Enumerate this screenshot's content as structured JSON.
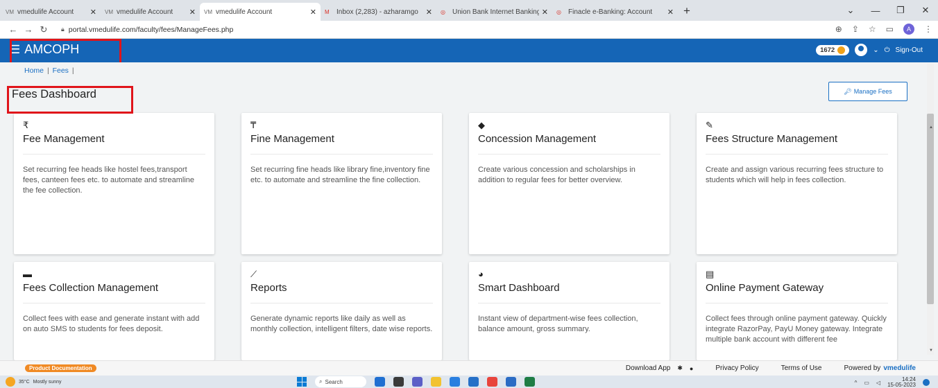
{
  "browser": {
    "tabs": [
      {
        "title": "vmedulife Account"
      },
      {
        "title": "vmedulife Account"
      },
      {
        "title": "vmedulife Account"
      },
      {
        "title": "Inbox (2,283) - azharamgo"
      },
      {
        "title": "Union Bank Internet Banking"
      },
      {
        "title": "Finacle e-Banking: Account"
      }
    ],
    "url": "portal.vmedulife.com/faculty/fees/ManageFees.php",
    "profile_initial": "A"
  },
  "header": {
    "brand": "AMCOPH",
    "coins": "1672",
    "signout": "Sign-Out"
  },
  "breadcrumb": {
    "home": "Home",
    "fees": "Fees",
    "sep": "|"
  },
  "page": {
    "title": "Fees Dashboard",
    "manage_fees": "Manage Fees"
  },
  "cards": [
    {
      "icon": "rupee-icon",
      "glyph": "₹",
      "title": "Fee Management",
      "desc": "Set recurring fee heads like hostel fees,transport fees, canteen fees etc. to automate and streamline the fee collection."
    },
    {
      "icon": "fine-icon",
      "glyph": "₸",
      "title": "Fine Management",
      "desc": "Set recurring fine heads like library fine,inventory fine etc. to automate and streamline the fine collection."
    },
    {
      "icon": "tags-icon",
      "glyph": "◆",
      "title": "Concession Management",
      "desc": "Create various concession and scholarships in addition to regular fees for better overview."
    },
    {
      "icon": "wrench-icon",
      "glyph": "✎",
      "title": "Fees Structure Management",
      "desc": "Create and assign various recurring fees structure to students which will help in fees collection."
    },
    {
      "icon": "wallet-icon",
      "glyph": "▬",
      "title": "Fees Collection Management",
      "desc": "Collect fees with ease and generate instant with add on auto SMS to students for fees deposit."
    },
    {
      "icon": "line-chart-icon",
      "glyph": "⟋",
      "title": "Reports",
      "desc": "Generate dynamic reports like daily as well as monthly collection, intelligent filters, date wise reports."
    },
    {
      "icon": "pie-chart-icon",
      "glyph": "◕",
      "title": "Smart Dashboard",
      "desc": "Instant view of department-wise fees collection, balance amount, gross summary."
    },
    {
      "icon": "credit-card-icon",
      "glyph": "▤",
      "title": "Online Payment Gateway",
      "desc": "Collect fees through online payment gateway. Quickly integrate RazorPay, PayU Money gateway. Integrate multiple bank account with different fee"
    }
  ],
  "footer": {
    "product_doc": "Product Documentation",
    "download_app": "Download App",
    "privacy": "Privacy Policy",
    "terms": "Terms of Use",
    "powered": "Powered by",
    "powered_brand": "vmedulife"
  },
  "taskbar": {
    "temp": "35°C",
    "weather": "Mostly sunny",
    "search": "Search",
    "time": "14:24",
    "date": "15-05-2023"
  },
  "colors": {
    "header_bg": "#1565b6",
    "link": "#1a6fc3",
    "highlight_box": "#e0141a",
    "doc_badge": "#f08a24"
  }
}
